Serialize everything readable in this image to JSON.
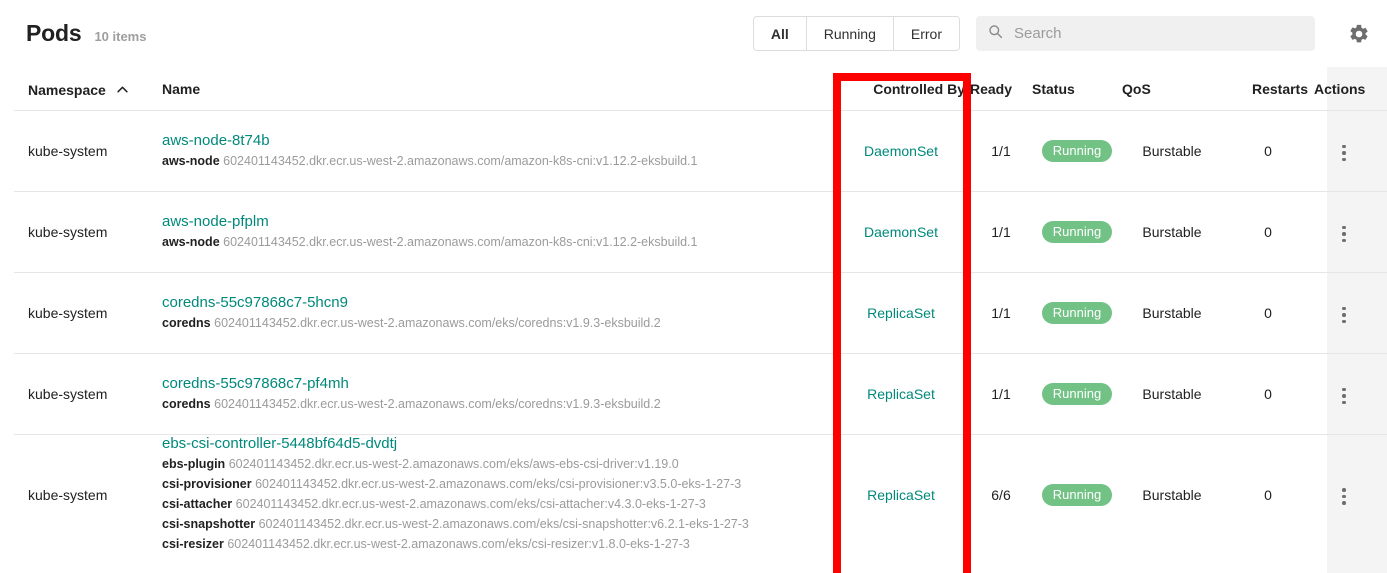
{
  "header": {
    "title": "Pods",
    "item_count": "10 items",
    "filters": [
      {
        "label": "All",
        "active": true
      },
      {
        "label": "Running",
        "active": false
      },
      {
        "label": "Error",
        "active": false
      }
    ],
    "search": {
      "placeholder": "Search",
      "value": "",
      "icon": "search-icon"
    },
    "settings_icon": "gear-icon"
  },
  "table": {
    "columns": {
      "namespace": "Namespace",
      "name": "Name",
      "controlled_by": "Controlled By",
      "ready": "Ready",
      "status": "Status",
      "qos": "QoS",
      "restarts": "Restarts",
      "actions": "Actions"
    },
    "sort": {
      "column": "Namespace",
      "direction": "asc",
      "icon": "chevron-up-icon"
    },
    "rows": [
      {
        "namespace": "kube-system",
        "name": "aws-node-8t74b",
        "containers": [
          {
            "name": "aws-node",
            "image": "602401143452.dkr.ecr.us-west-2.amazonaws.com/amazon-k8s-cni:v1.12.2-eksbuild.1"
          }
        ],
        "controlled_by": "DaemonSet",
        "ready": "1/1",
        "status": "Running",
        "qos": "Burstable",
        "restarts": "0"
      },
      {
        "namespace": "kube-system",
        "name": "aws-node-pfplm",
        "containers": [
          {
            "name": "aws-node",
            "image": "602401143452.dkr.ecr.us-west-2.amazonaws.com/amazon-k8s-cni:v1.12.2-eksbuild.1"
          }
        ],
        "controlled_by": "DaemonSet",
        "ready": "1/1",
        "status": "Running",
        "qos": "Burstable",
        "restarts": "0"
      },
      {
        "namespace": "kube-system",
        "name": "coredns-55c97868c7-5hcn9",
        "containers": [
          {
            "name": "coredns",
            "image": "602401143452.dkr.ecr.us-west-2.amazonaws.com/eks/coredns:v1.9.3-eksbuild.2"
          }
        ],
        "controlled_by": "ReplicaSet",
        "ready": "1/1",
        "status": "Running",
        "qos": "Burstable",
        "restarts": "0"
      },
      {
        "namespace": "kube-system",
        "name": "coredns-55c97868c7-pf4mh",
        "containers": [
          {
            "name": "coredns",
            "image": "602401143452.dkr.ecr.us-west-2.amazonaws.com/eks/coredns:v1.9.3-eksbuild.2"
          }
        ],
        "controlled_by": "ReplicaSet",
        "ready": "1/1",
        "status": "Running",
        "qos": "Burstable",
        "restarts": "0"
      },
      {
        "namespace": "kube-system",
        "name": "ebs-csi-controller-5448bf64d5-dvdtj",
        "containers": [
          {
            "name": "ebs-plugin",
            "image": "602401143452.dkr.ecr.us-west-2.amazonaws.com/eks/aws-ebs-csi-driver:v1.19.0"
          },
          {
            "name": "csi-provisioner",
            "image": "602401143452.dkr.ecr.us-west-2.amazonaws.com/eks/csi-provisioner:v3.5.0-eks-1-27-3"
          },
          {
            "name": "csi-attacher",
            "image": "602401143452.dkr.ecr.us-west-2.amazonaws.com/eks/csi-attacher:v4.3.0-eks-1-27-3"
          },
          {
            "name": "csi-snapshotter",
            "image": "602401143452.dkr.ecr.us-west-2.amazonaws.com/eks/csi-snapshotter:v6.2.1-eks-1-27-3"
          },
          {
            "name": "csi-resizer",
            "image": "602401143452.dkr.ecr.us-west-2.amazonaws.com/eks/csi-resizer:v1.8.0-eks-1-27-3"
          }
        ],
        "controlled_by": "ReplicaSet",
        "ready": "6/6",
        "status": "Running",
        "qos": "Burstable",
        "restarts": "0"
      }
    ]
  },
  "annotation": {
    "highlight_color": "#ff0000",
    "highlighted_column": "Controlled By"
  }
}
